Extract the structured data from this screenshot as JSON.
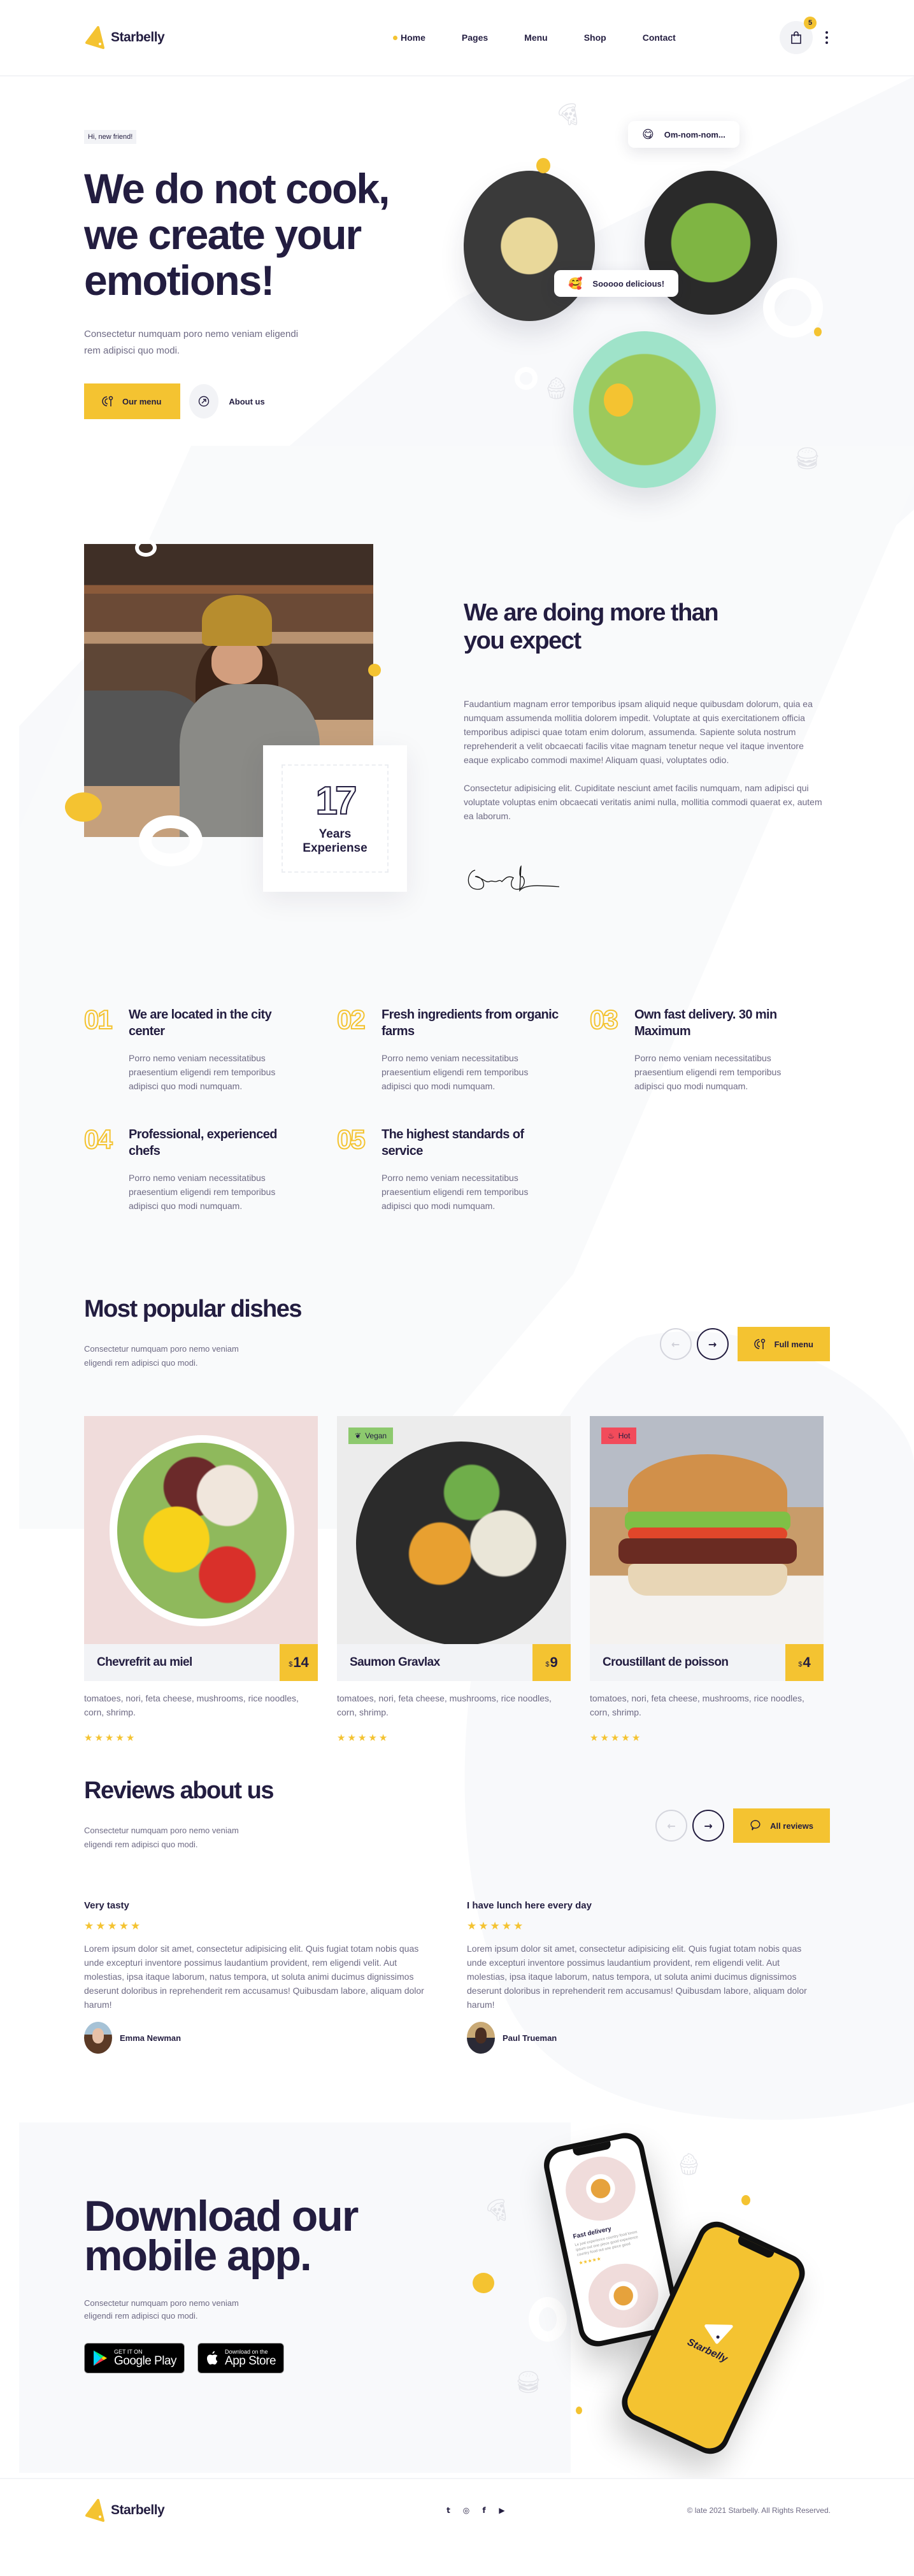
{
  "brand": {
    "name": "Starbelly",
    "accent_color": "#f4c331",
    "dark_color": "#231d40",
    "muted_color": "#6e6a84",
    "vegan_color": "#8dc96e",
    "hot_color": "#f24b5b"
  },
  "header": {
    "nav": [
      {
        "label": "Home",
        "active": true
      },
      {
        "label": "Pages",
        "active": false
      },
      {
        "label": "Menu",
        "active": false
      },
      {
        "label": "Shop",
        "active": false
      },
      {
        "label": "Contact",
        "active": false
      }
    ],
    "cart_count": "5",
    "cart_icon": "shopping-bag-icon",
    "more_icon": "kebab-menu-icon"
  },
  "hero": {
    "tag": "Hi, new friend!",
    "title": "We do not cook, we create your emotions!",
    "subtitle": "Consectetur numquam poro nemo veniam eligendi rem adipisci quo modi.",
    "primary_button": "Our menu",
    "secondary_button": "About us",
    "bubbles": [
      {
        "emoji": "😋",
        "text": "Om-nom-nom..."
      },
      {
        "emoji": "🥰",
        "text": "Sooooo delicious!"
      }
    ]
  },
  "about": {
    "years": "17",
    "years_label_1": "Years",
    "years_label_2": "Experiense",
    "title": "We are doing more than you expect",
    "paragraphs": [
      "Faudantium magnam error temporibus ipsam aliquid neque quibusdam dolorum, quia ea numquam assumenda mollitia dolorem impedit. Voluptate at quis exercitationem officia temporibus adipisci quae totam enim dolorum, assumenda. Sapiente soluta nostrum reprehenderit a velit obcaecati facilis vitae magnam tenetur neque vel itaque inventore eaque explicabo commodi maxime! Aliquam quasi, voluptates odio.",
      "Consectetur adipisicing elit. Cupiditate nesciunt amet facilis numquam, nam adipisci qui voluptate voluptas enim obcaecati veritatis animi nulla, mollitia commodi quaerat ex, autem ea laborum."
    ]
  },
  "features": [
    {
      "num": "01",
      "title": "We are located in the city center",
      "desc": "Porro nemo veniam necessitatibus praesentium eligendi rem temporibus adipisci quo modi numquam."
    },
    {
      "num": "02",
      "title": "Fresh ingredients from organic farms",
      "desc": "Porro nemo veniam necessitatibus praesentium eligendi rem temporibus adipisci quo modi numquam."
    },
    {
      "num": "03",
      "title": "Own fast delivery. 30 min Maximum",
      "desc": "Porro nemo veniam necessitatibus praesentium eligendi rem temporibus adipisci quo modi numquam."
    },
    {
      "num": "04",
      "title": "Professional, experienced chefs",
      "desc": "Porro nemo veniam necessitatibus praesentium eligendi rem temporibus adipisci quo modi numquam."
    },
    {
      "num": "05",
      "title": "The highest standards of service",
      "desc": "Porro nemo veniam necessitatibus praesentium eligendi rem temporibus adipisci quo modi numquam."
    }
  ],
  "dishes": {
    "title": "Most popular dishes",
    "subtitle": "Consectetur numquam poro nemo veniam eligendi rem adipisci quo modi.",
    "button": "Full menu",
    "items": [
      {
        "name": "Chevrefrit au miel",
        "currency": "$",
        "price": "14",
        "badge": "",
        "desc": "tomatoes, nori, feta cheese, mushrooms, rice noodles, corn, shrimp.",
        "rating": 5
      },
      {
        "name": "Saumon Gravlax",
        "currency": "$",
        "price": "9",
        "badge": "Vegan",
        "desc": "tomatoes, nori, feta cheese, mushrooms, rice noodles, corn, shrimp.",
        "rating": 5
      },
      {
        "name": "Croustillant de poisson",
        "currency": "$",
        "price": "4",
        "badge": "Hot",
        "desc": "tomatoes, nori, feta cheese, mushrooms, rice noodles, corn, shrimp.",
        "rating": 5
      }
    ]
  },
  "reviews": {
    "title": "Reviews about us",
    "subtitle": "Consectetur numquam poro nemo veniam eligendi rem adipisci quo modi.",
    "button": "All reviews",
    "items": [
      {
        "title": "Very tasty",
        "rating": 5,
        "text": "Lorem ipsum dolor sit amet, consectetur adipisicing elit. Quis fugiat totam nobis quas unde excepturi inventore possimus laudantium provident, rem eligendi velit. Aut molestias, ipsa itaque laborum, natus tempora, ut soluta animi ducimus dignissimos deserunt doloribus in reprehenderit rem accusamus! Quibusdam labore, aliquam dolor harum!",
        "author": "Emma Newman"
      },
      {
        "title": "I have lunch here every day",
        "rating": 5,
        "text": "Lorem ipsum dolor sit amet, consectetur adipisicing elit. Quis fugiat totam nobis quas unde excepturi inventore possimus laudantium provident, rem eligendi velit. Aut molestias, ipsa itaque laborum, natus tempora, ut soluta animi ducimus dignissimos deserunt doloribus in reprehenderit rem accusamus! Quibusdam labore, aliquam dolor harum!",
        "author": "Paul Trueman"
      }
    ]
  },
  "app": {
    "title_line1": "Download our",
    "title_line2": "mobile app.",
    "subtitle": "Consectetur numquam poro nemo veniam eligendi rem adipisci quo modi.",
    "google_small": "GET IT ON",
    "google_big": "Google Play",
    "apple_small": "Download on the",
    "apple_big": "App Store",
    "phone_card_title": "Fast delivery",
    "phone_card_text": "Le just experience country food lorem ipsum out one piece good experience country food out one piece good",
    "phone_brand": "Starbelly"
  },
  "footer": {
    "social": [
      {
        "name": "twitter",
        "glyph": "t"
      },
      {
        "name": "instagram",
        "glyph": "◎"
      },
      {
        "name": "facebook",
        "glyph": "f"
      },
      {
        "name": "youtube",
        "glyph": "▶"
      }
    ],
    "copyright": "© late 2021 Starbelly. All Rights Reserved."
  }
}
